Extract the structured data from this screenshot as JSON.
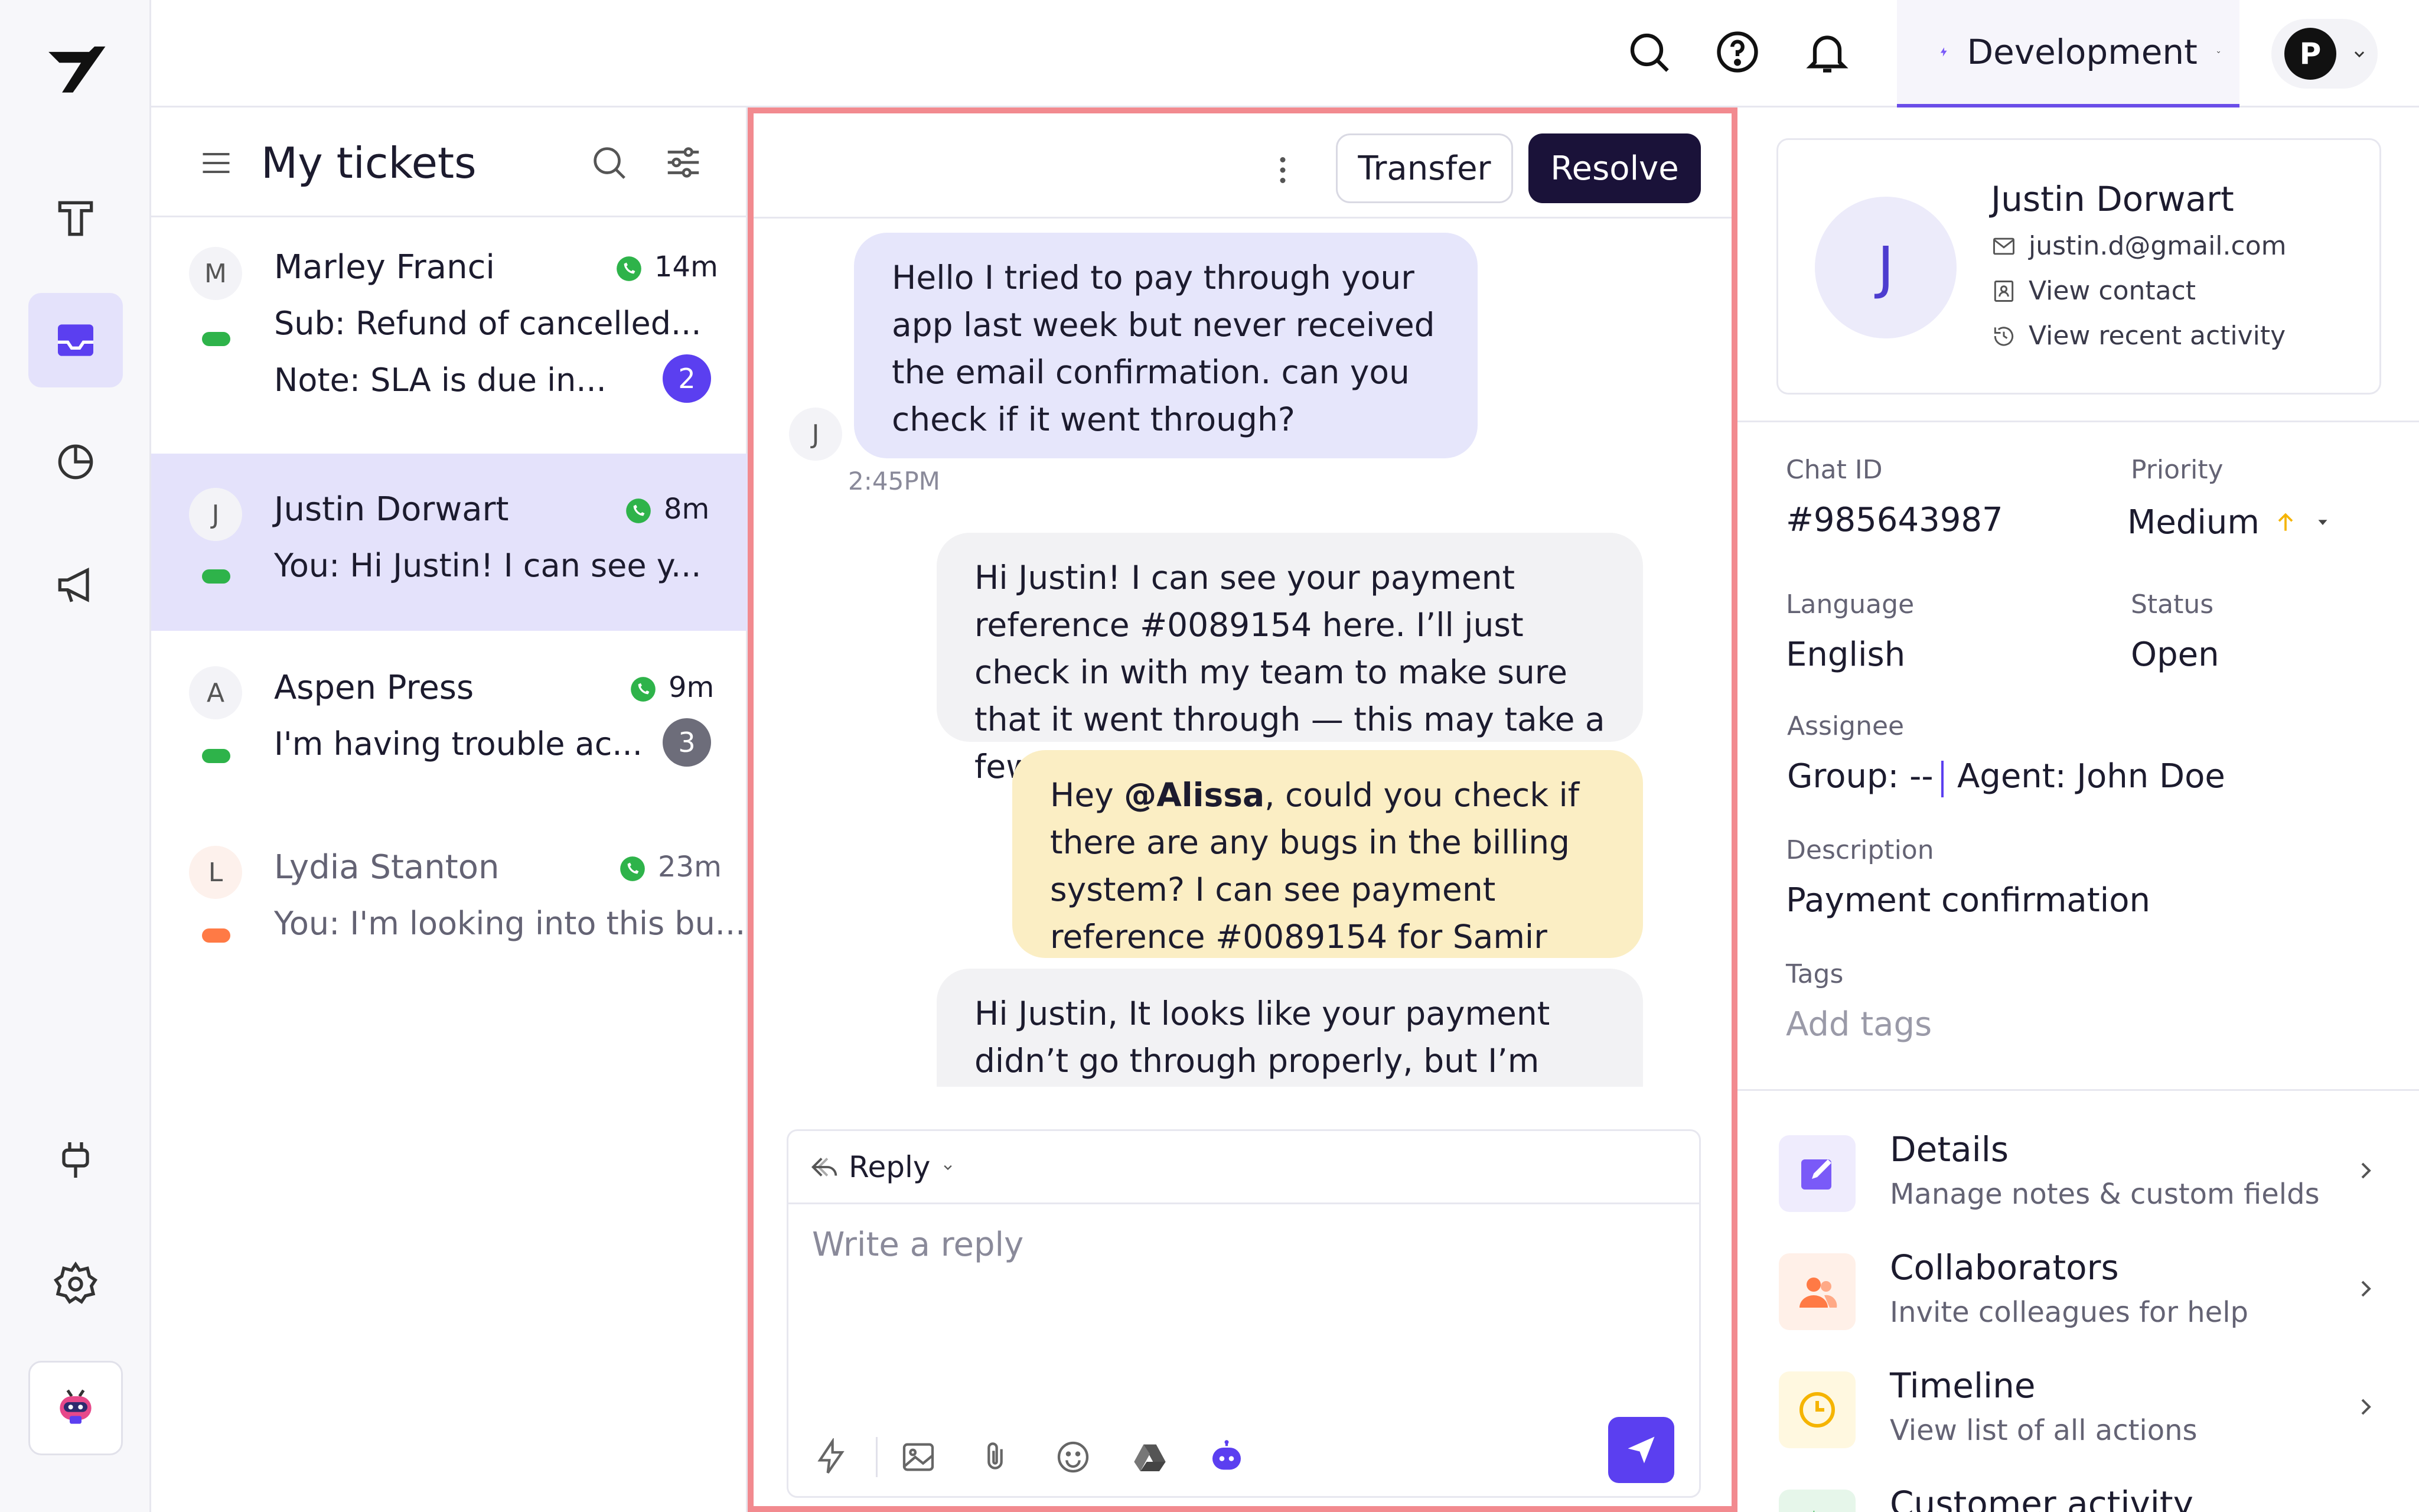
{
  "colors": {
    "accent": "#5b3ff0",
    "brand_dark": "#1a1239",
    "highlight_border": "#f28a8f",
    "online": "#2eb34a",
    "away": "#ff7a45",
    "selected_row": "#e4e2fb",
    "note_bubble": "#fbeec4"
  },
  "nav": {
    "icons": [
      "logo-icon",
      "text-tool-icon",
      "inbox-icon",
      "analytics-icon",
      "campaigns-icon",
      "integrations-icon",
      "settings-icon",
      "bot-icon"
    ]
  },
  "topbar": {
    "environment": "Development",
    "profile_initial": "P"
  },
  "tickets": {
    "title": "My tickets",
    "items": [
      {
        "initial": "M",
        "name": "Marley Franci",
        "time": "14m",
        "line1": "Sub: Refund of cancelled...",
        "line2": "Note: SLA is due in...",
        "badge": "2",
        "status": "online"
      },
      {
        "initial": "J",
        "name": "Justin Dorwart",
        "time": "8m",
        "line1": "You: Hi Justin! I can see y...",
        "status": "online",
        "selected": true
      },
      {
        "initial": "A",
        "name": "Aspen Press",
        "time": "9m",
        "line1": "I'm having trouble ac...",
        "badge": "3",
        "status": "online"
      },
      {
        "initial": "L",
        "name": "Lydia Stanton",
        "time": "23m",
        "line1": "You: I'm looking into this bu...",
        "status": "away"
      }
    ]
  },
  "conversation": {
    "transfer_label": "Transfer",
    "resolve_label": "Resolve",
    "customer_initial": "J",
    "messages": [
      {
        "from": "customer",
        "text": "Hello I tried to pay through your app last week but never received the email confirmation. can you check if it went through?",
        "time": "2:45PM"
      },
      {
        "from": "agent",
        "text": "Hi Justin! I can see your payment reference #0089154 here. I’ll just check in with my team to make sure that it went through — this may take a few moments."
      },
      {
        "from": "note",
        "before": "Hey ",
        "mention": "@Alissa",
        "after": ", could you check if there are any bugs in the billing system? I can see payment reference #0089154 for Samir here."
      },
      {
        "from": "agent",
        "text": "Hi Justin, It looks like your payment didn’t go through properly, but I’m correcting"
      }
    ],
    "composer": {
      "mode_label": "Reply",
      "placeholder": "Write a reply",
      "tools": [
        "lightning-icon",
        "image-icon",
        "attachment-icon",
        "emoji-icon",
        "drive-icon",
        "bot-icon"
      ]
    }
  },
  "contact": {
    "initial": "J",
    "name": "Justin Dorwart",
    "email": "justin.d@gmail.com",
    "view_contact": "View contact",
    "view_activity": "View recent activity"
  },
  "fields": {
    "chat_id_label": "Chat ID",
    "chat_id": "#985643987",
    "priority_label": "Priority",
    "priority": "Medium",
    "language_label": "Language",
    "language": "English",
    "status_label": "Status",
    "status": "Open",
    "assignee_label": "Assignee",
    "group": "Group: --",
    "agent": "Agent: John Doe",
    "description_label": "Description",
    "description": "Payment confirmation",
    "tags_label": "Tags",
    "tags_placeholder": "Add tags"
  },
  "sections": [
    {
      "title": "Details",
      "subtitle": "Manage notes & custom fields",
      "icon": "edit-icon",
      "color": "#7a5af8",
      "bg": "#efecfd"
    },
    {
      "title": "Collaborators",
      "subtitle": "Invite colleagues for help",
      "icon": "users-icon",
      "color": "#ff7a45",
      "bg": "#fff0e8"
    },
    {
      "title": "Timeline",
      "subtitle": "View list of all actions",
      "icon": "clock-icon",
      "color": "#f5b400",
      "bg": "#fff8e0"
    },
    {
      "title": "Customer activity",
      "icon": "activity-icon",
      "color": "#2eb34a",
      "bg": "#e6f6ea"
    }
  ]
}
